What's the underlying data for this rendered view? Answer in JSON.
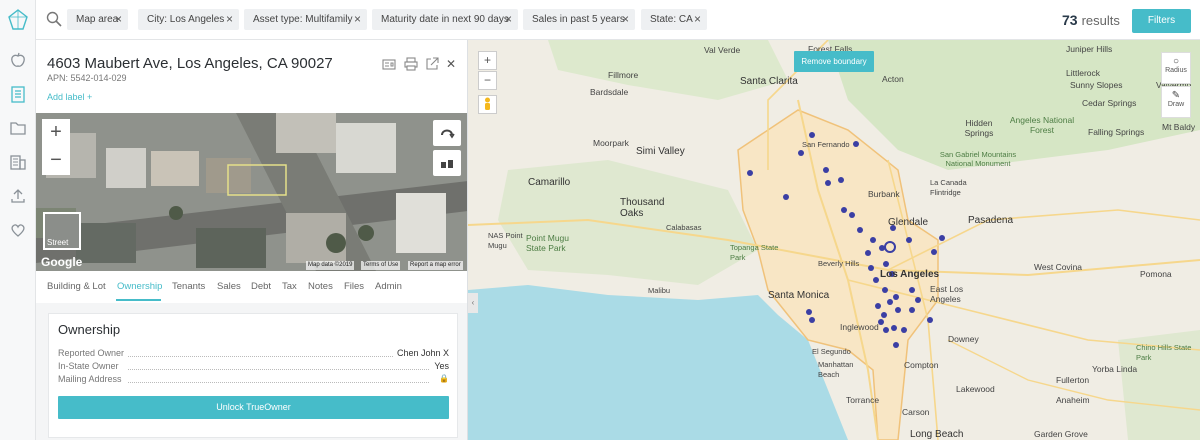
{
  "topbar": {
    "filter_chips": [
      {
        "label": "Map area"
      },
      {
        "label": "City: Los Angeles"
      },
      {
        "label": "Asset type: Multifamily"
      },
      {
        "label": "Maturity date in next 90 days"
      },
      {
        "label": "Sales in past 5 years"
      },
      {
        "label": "State: CA"
      }
    ],
    "chip_remove_glyph": "×",
    "results_count": "73",
    "results_label": "results",
    "filters_label": "Filters"
  },
  "sidebar": {
    "icons": [
      "logo-icon",
      "apple-icon",
      "clipboard-icon",
      "folder-icon",
      "building-icon",
      "upload-icon",
      "heart-icon"
    ]
  },
  "property": {
    "address": "4603 Maubert Ave, Los Angeles, CA 90027",
    "apn": "APN: 5542-014-029",
    "add_label": "Add label +",
    "header_icons": [
      "property-card-icon",
      "print-icon",
      "open-external-icon",
      "close-icon"
    ],
    "close_glyph": "✕"
  },
  "streetview": {
    "zoom_in": "+",
    "zoom_out": "−",
    "street_label": "Street",
    "google": "Google",
    "attribution": [
      "Map data ©2019",
      "Terms of Use",
      "Report a map error"
    ]
  },
  "tabs": [
    {
      "label": "Building & Lot",
      "active": false
    },
    {
      "label": "Ownership",
      "active": true
    },
    {
      "label": "Tenants",
      "active": false
    },
    {
      "label": "Sales",
      "active": false
    },
    {
      "label": "Debt",
      "active": false
    },
    {
      "label": "Tax",
      "active": false
    },
    {
      "label": "Notes",
      "active": false
    },
    {
      "label": "Files",
      "active": false
    },
    {
      "label": "Admin",
      "active": false
    }
  ],
  "ownership": {
    "title": "Ownership",
    "rows": [
      {
        "label": "Reported Owner",
        "value": "Chen John X"
      },
      {
        "label": "In-State Owner",
        "value": "Yes"
      },
      {
        "label": "Mailing Address",
        "value": "🔒"
      }
    ],
    "unlock_label": "Unlock TrueOwner"
  },
  "map": {
    "zoom_in": "+",
    "zoom_out": "−",
    "remove_boundary": "Remove boundary",
    "tools": [
      {
        "label": "Radius",
        "icon": "○"
      },
      {
        "label": "Draw",
        "icon": "✎"
      }
    ],
    "collapse_glyph": "‹",
    "places": [
      {
        "name": "Val Verde",
        "kind": "normal"
      },
      {
        "name": "Forest Falls",
        "kind": "normal"
      },
      {
        "name": "Juniper Hills",
        "kind": "normal"
      },
      {
        "name": "Fillmore",
        "kind": "normal"
      },
      {
        "name": "Santa Clarita",
        "kind": "big"
      },
      {
        "name": "Bardsdale",
        "kind": "normal"
      },
      {
        "name": "Acton",
        "kind": "normal"
      },
      {
        "name": "Littlerock",
        "kind": "normal"
      },
      {
        "name": "Sunny Slopes",
        "kind": "normal"
      },
      {
        "name": "Angeles National Forest",
        "kind": "green"
      },
      {
        "name": "Valyermo",
        "kind": "normal"
      },
      {
        "name": "Cedar Springs",
        "kind": "normal"
      },
      {
        "name": "Hidden Springs",
        "kind": "normal"
      },
      {
        "name": "San Gabriel Mountains National Monument",
        "kind": "green"
      },
      {
        "name": "Falling Springs",
        "kind": "normal"
      },
      {
        "name": "Moorpark",
        "kind": "normal"
      },
      {
        "name": "Simi Valley",
        "kind": "big"
      },
      {
        "name": "Mt Baldy",
        "kind": "normal"
      },
      {
        "name": "San Fernando",
        "kind": "normal"
      },
      {
        "name": "Camarillo",
        "kind": "big"
      },
      {
        "name": "Thousand Oaks",
        "kind": "big"
      },
      {
        "name": "Burbank",
        "kind": "normal"
      },
      {
        "name": "La Canada Flintridge",
        "kind": "normal"
      },
      {
        "name": "Glendale",
        "kind": "big"
      },
      {
        "name": "Pasadena",
        "kind": "big"
      },
      {
        "name": "NAS Point Mugu",
        "kind": "normal"
      },
      {
        "name": "Point Mugu State Park",
        "kind": "green"
      },
      {
        "name": "Calabasas",
        "kind": "normal"
      },
      {
        "name": "Topanga State Park",
        "kind": "green"
      },
      {
        "name": "Beverly Hills",
        "kind": "normal"
      },
      {
        "name": "Los Angeles",
        "kind": "big"
      },
      {
        "name": "West Covina",
        "kind": "normal"
      },
      {
        "name": "Pomona",
        "kind": "normal"
      },
      {
        "name": "Malibu",
        "kind": "normal"
      },
      {
        "name": "Santa Monica",
        "kind": "big"
      },
      {
        "name": "East Los Angeles",
        "kind": "normal"
      },
      {
        "name": "Inglewood",
        "kind": "normal"
      },
      {
        "name": "Downey",
        "kind": "normal"
      },
      {
        "name": "El Segundo",
        "kind": "normal"
      },
      {
        "name": "Manhattan Beach",
        "kind": "normal"
      },
      {
        "name": "Compton",
        "kind": "normal"
      },
      {
        "name": "Chino Hills State Park",
        "kind": "green"
      },
      {
        "name": "Yorba Linda",
        "kind": "normal"
      },
      {
        "name": "Fullerton",
        "kind": "normal"
      },
      {
        "name": "Lakewood",
        "kind": "normal"
      },
      {
        "name": "Anaheim",
        "kind": "normal"
      },
      {
        "name": "Garden Grove",
        "kind": "normal"
      },
      {
        "name": "Long Beach",
        "kind": "big"
      },
      {
        "name": "Torrance",
        "kind": "normal"
      },
      {
        "name": "Carson",
        "kind": "normal"
      }
    ]
  },
  "colors": {
    "accent": "#46bcc9",
    "pin": "#3b3fa4",
    "boundary": "#f0c27a",
    "water": "#aadbe6",
    "terrain": "#d9e7c8"
  }
}
